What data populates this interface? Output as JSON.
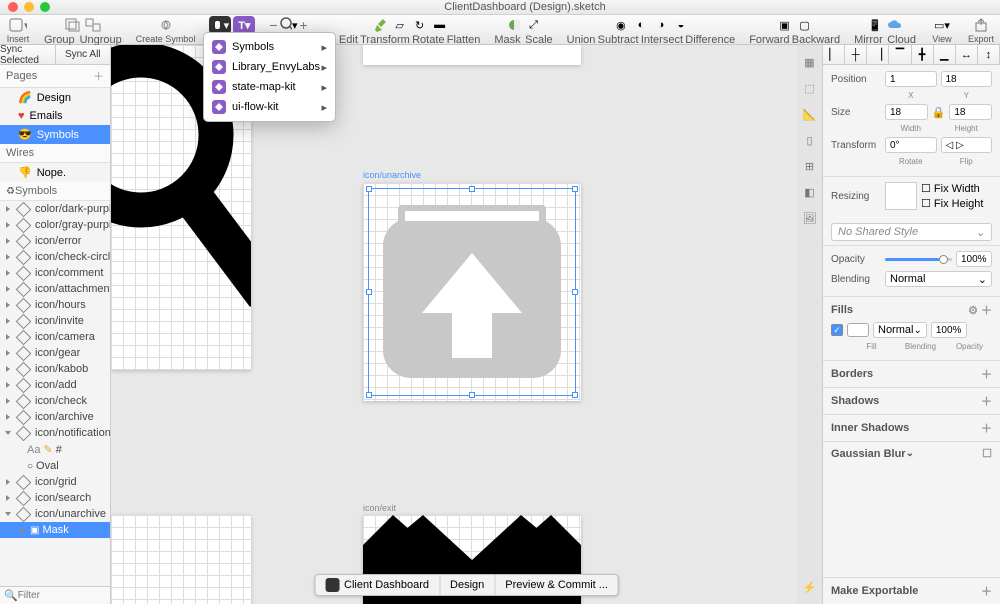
{
  "window": {
    "title": "ClientDashboard (Design).sketch"
  },
  "toolbar": {
    "insert": "Insert",
    "group": "Group",
    "ungroup": "Ungroup",
    "create_symbol": "Create Symbol",
    "edit": "Edit",
    "transform": "Transform",
    "rotate": "Rotate",
    "flatten": "Flatten",
    "mask": "Mask",
    "scale": "Scale",
    "union": "Union",
    "subtract": "Subtract",
    "intersect": "Intersect",
    "difference": "Difference",
    "forward": "Forward",
    "backward": "Backward",
    "mirror": "Mirror",
    "cloud": "Cloud",
    "view": "View",
    "export": "Export"
  },
  "dropdown": {
    "items": [
      {
        "label": "Symbols"
      },
      {
        "label": "Library_EnvyLabs"
      },
      {
        "label": "state-map-kit"
      },
      {
        "label": "ui-flow-kit"
      }
    ]
  },
  "sync": {
    "sync_selected": "Sync Selected",
    "sync_all": "Sync All"
  },
  "pages": {
    "header": "Pages",
    "items": [
      {
        "icon": "🌈",
        "label": "Design"
      },
      {
        "icon": "♥",
        "label": "Emails",
        "red": true
      },
      {
        "icon": "😎",
        "label": "Symbols",
        "selected": true
      }
    ],
    "wires": "Wires",
    "nope": {
      "icon": "👎",
      "label": "Nope."
    }
  },
  "layers": {
    "header": "Symbols",
    "items": [
      "color/dark-purple",
      "color/gray-purple",
      "icon/error",
      "icon/check-circle",
      "icon/comment",
      "icon/attachment",
      "icon/hours",
      "icon/invite",
      "icon/camera",
      "icon/gear",
      "icon/kabob",
      "icon/add",
      "icon/check",
      "icon/archive",
      "icon/notification"
    ],
    "notification_children": {
      "aa": "Aa",
      "hash": "#",
      "oval": "Oval"
    },
    "more": [
      "icon/grid",
      "icon/search",
      "icon/unarchive"
    ],
    "unarchive_child": "Mask"
  },
  "filter_placeholder": "Filter",
  "canvas": {
    "selected_label": "icon/unarchive",
    "exit_label": "icon/exit"
  },
  "breadcrumb": {
    "project": "Client Dashboard",
    "doc": "Design",
    "preview": "Preview & Commit ..."
  },
  "inspector": {
    "position": "Position",
    "pos_x": "1",
    "pos_y": "18",
    "x": "X",
    "y": "Y",
    "size": "Size",
    "w": "18",
    "h": "18",
    "width": "Width",
    "height": "Height",
    "transform": "Transform",
    "rot": "0°",
    "rotate": "Rotate",
    "flip": "Flip",
    "resizing": "Resizing",
    "fix_width": "Fix Width",
    "fix_height": "Fix Height",
    "no_shared": "No Shared Style",
    "opacity": "Opacity",
    "opacity_val": "100%",
    "blending": "Blending",
    "blend_mode": "Normal",
    "fills": "Fills",
    "fill_mode": "Normal",
    "fill_opacity": "100%",
    "fill_lbl": "Fill",
    "blend_lbl": "Blending",
    "op_lbl": "Opacity",
    "borders": "Borders",
    "shadows": "Shadows",
    "inner_shadows": "Inner Shadows",
    "gaussian": "Gaussian Blur",
    "make_exportable": "Make Exportable"
  }
}
